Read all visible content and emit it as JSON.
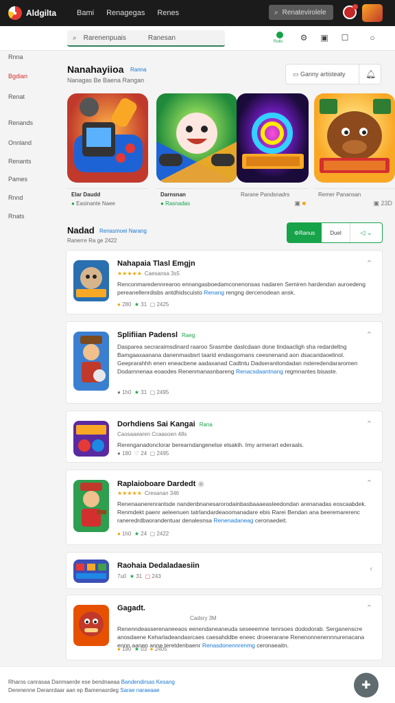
{
  "topbar": {
    "brand": "Aldgilta",
    "nav": [
      "Bami",
      "Renagegas",
      "Renes"
    ],
    "search": "Renatevirolele"
  },
  "subbar": {
    "search_placeholder": "Rarenenpuais",
    "search_hint": "Ranesan",
    "status_label": "Rolls"
  },
  "sidebar": {
    "items": [
      "Rnna",
      "Bgdian",
      "Renat",
      "Renands",
      "Onnland",
      "Renants",
      "Pames",
      "Rnnd",
      "Rnats"
    ],
    "active_index": 1
  },
  "header": {
    "title": "Nanahayiioa",
    "title_tag": "Ranna",
    "subtitle": "Nanagas Be Baena Rangan",
    "tool_label": "Ganny artisteaty"
  },
  "featured": [
    {
      "name": "Elar Daudd",
      "meta": "Easinante Naee",
      "icon": "controller-art"
    },
    {
      "name": "Darnsnan",
      "meta": "Rasnadas",
      "icon": "smiley-art"
    },
    {
      "name": "Rarane Pandsnadrs",
      "meta": "",
      "icon": "swirl-art"
    },
    {
      "name": "Remer Panansan",
      "meta": "23D",
      "icon": "bull-art"
    }
  ],
  "section": {
    "title": "Nadad",
    "tag": "Renasmoei Narang",
    "subtitle": "Ranerre Ra ge 2422",
    "seg_active": "Ranus",
    "seg_other": "Duel",
    "seg_icon": "filter-icon"
  },
  "apps": [
    {
      "title": "Nahapaia Tlasl Emgjn",
      "tag": "",
      "rating": "Caesansa 3s5",
      "desc": "Renconmaredennrearoo ennangasboedamconenonsas nadaren Semiren hardendan auroedeng pereanellenrdisbs antdhidscuisto",
      "desc_link": "Renang",
      "desc_end": "rengng dercenodean ansk.",
      "stats": [
        "280",
        "31",
        "2425"
      ]
    },
    {
      "title": "Splifiian Padensl",
      "tag": "Raeg",
      "rating": "",
      "desc": "Dasparea secraraimsdinard raaroo Srasmbe daslcdaan done tindaacligh sha redardeltng Bamgaaxaanana danenmasbsrt taarid endasgomans ceesnenand aon dsacaridaoelinol. Geeprarahhh enen eneacbene aadaxanad Cadtntu Dadseranitondadan nsteredendararomen Dodarnnenaa eoaodes Renenmanasnbareng",
      "desc_link": "Renacsdaantnang",
      "desc_end": "regmnantes bisaste.",
      "stats": [
        "1h0",
        "31",
        "2495"
      ]
    },
    {
      "title": "Dorhdiens Sai Kangai",
      "tag": "Rana",
      "rating": "Caosaaearen Ccaasoen 48s",
      "desc": "Rerenganadonclorar berearndangenelse elsakih. Imy armerart ederaals.",
      "desc_link": "",
      "desc_end": "",
      "stats": [
        "180",
        "24",
        "2495"
      ]
    },
    {
      "title": "Raplaioboare Dardedt",
      "tag": "",
      "rating": "Cresanan 346",
      "desc": "Renenaanerenrantsde nandenbnanesarorodainbasbaaaeasleedondan arenanadas eoscaabdek. Renmdekt paenr aeleenuen tatrlandardeaoomanadare ebis Rarei Bendan ana beeremarerenc raneredrdbaorandentuar denalesnsa",
      "desc_link": "Renenadaneag",
      "desc_end": "ceronaedeit.",
      "stats": [
        "1h0",
        "24",
        "2422"
      ]
    },
    {
      "title": "Raohaia Dedaladaesiin",
      "tag": "",
      "rating": "",
      "desc": "",
      "desc_link": "",
      "desc_end": "",
      "stats": [
        "7u0",
        "31",
        "243"
      ]
    },
    {
      "title": "Gagadt.",
      "tag": "",
      "rating": "Cadsry 3M",
      "desc": "Renenndeasserenaneeaos eenendaneaneuda seseeemne tenrsoes dododorab. Serganenscre anosdaene Keharladeandasrcaes caesahddbe eneec droeerarane Renenonnenennnurenacana ennn aanen anne teretdenbaenr",
      "desc_link": "Renasdonennrenmg",
      "desc_end": "ceronaeaitn.",
      "stats": [
        "190",
        "03",
        "2405"
      ]
    }
  ],
  "footer": {
    "line1": "Rharos canrasaa Danmaerde ese bendnaeaa",
    "line1_link": "Bandendirsas Kesang",
    "line2": "Derenenne Deranrdaar aan ep Bamenasrdeg",
    "line2_link": "Sarae naraeaae"
  },
  "colors": {
    "accent_green": "#16a34a",
    "link_blue": "#1976d2",
    "topbar_bg": "#1b1b1b",
    "star_orange": "#f4a300"
  }
}
